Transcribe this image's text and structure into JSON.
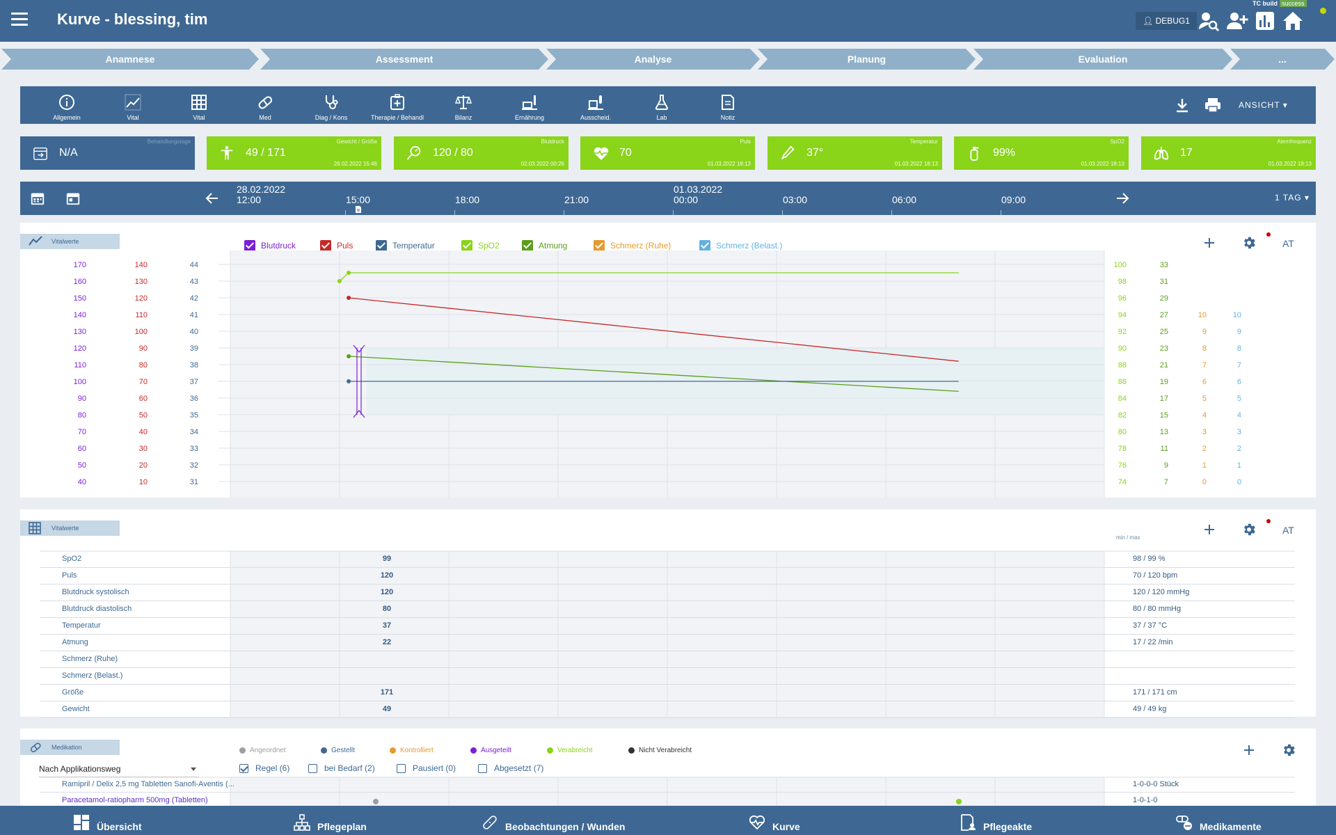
{
  "header": {
    "title": "Kurve - blessing, tim",
    "user": "DEBUG1",
    "tc_build": "TC build",
    "tc_status": "success"
  },
  "steps": [
    "Anamnese",
    "Assessment",
    "Analyse",
    "Planung",
    "Evaluation",
    "..."
  ],
  "toolbar": {
    "tools": [
      "Allgemein",
      "Vital",
      "Vital",
      "Med",
      "Diag / Kons",
      "Therapie / Behandl",
      "Bilanz",
      "Ernährung",
      "Ausscheid.",
      "Lab",
      "Notiz"
    ],
    "view_label": "ANSICHT"
  },
  "tiles": [
    {
      "caption": "Behandlungstage",
      "value": "N/A",
      "timestamp": ""
    },
    {
      "caption": "Gewicht / Größe",
      "value": "49 / 171",
      "timestamp": "28.02.2022 15:46"
    },
    {
      "caption": "Blutdruck",
      "value": "120 / 80",
      "timestamp": "02.03.2022 00:26"
    },
    {
      "caption": "Puls",
      "value": "70",
      "timestamp": "01.03.2022 18:13"
    },
    {
      "caption": "Temperatur",
      "value": "37°",
      "timestamp": "01.03.2022 18:13"
    },
    {
      "caption": "SpO2",
      "value": "99%",
      "timestamp": "01.03.2022 18:13"
    },
    {
      "caption": "Atemfrequenz",
      "value": "17",
      "timestamp": "01.03.2022 18:13"
    }
  ],
  "timebar": {
    "date1": "28.02.2022",
    "date2": "01.03.2022",
    "ticks": [
      "12:00",
      "15:00",
      "18:00",
      "21:00",
      "00:00",
      "03:00",
      "06:00",
      "09:00"
    ],
    "range": "1 TAG"
  },
  "chart_panel": {
    "tag": "Vitalwerte",
    "at": "AT",
    "legend": [
      {
        "name": "Blutdruck",
        "color": "#7b1fd6"
      },
      {
        "name": "Puls",
        "color": "#c62828"
      },
      {
        "name": "Temperatur",
        "color": "#3e6893"
      },
      {
        "name": "SpO2",
        "color": "#8ad41a"
      },
      {
        "name": "Atmung",
        "color": "#5a9e1b"
      },
      {
        "name": "Schmerz (Ruhe)",
        "color": "#e69a2e"
      },
      {
        "name": "Schmerz (Belast.)",
        "color": "#64b0e0"
      }
    ]
  },
  "chart_data": {
    "type": "line",
    "x_hours_labels": [
      "12:00",
      "15:00",
      "18:00",
      "21:00",
      "00:00",
      "03:00",
      "06:00",
      "09:00"
    ],
    "axes": {
      "blutdruck": {
        "ticks": [
          170,
          160,
          150,
          140,
          130,
          120,
          110,
          100,
          90,
          80,
          70,
          60,
          50,
          40
        ],
        "color": "#7b1fd6"
      },
      "puls": {
        "ticks": [
          140,
          130,
          120,
          110,
          100,
          90,
          80,
          70,
          60,
          50,
          40,
          30,
          20,
          10
        ],
        "color": "#c62828"
      },
      "temperatur": {
        "ticks": [
          44,
          43,
          42,
          41,
          40,
          39,
          38,
          37,
          36,
          35,
          34,
          33,
          32,
          31
        ],
        "color": "#3e6893"
      },
      "spo2": {
        "ticks": [
          100,
          98,
          96,
          94,
          92,
          90,
          88,
          86,
          84,
          82,
          80,
          78,
          76,
          74
        ],
        "color": "#8ad41a"
      },
      "atmung": {
        "ticks": [
          33,
          31,
          29,
          27,
          25,
          23,
          21,
          19,
          17,
          15,
          13,
          11,
          9,
          7
        ],
        "color": "#5a9e1b"
      },
      "schmerz_ruhe": {
        "ticks": [
          10,
          9,
          8,
          7,
          6,
          5,
          4,
          3,
          2,
          1,
          0
        ],
        "color": "#e69a2e"
      },
      "schmerz_belast": {
        "ticks": [
          10,
          9,
          8,
          7,
          6,
          5,
          4,
          3,
          2,
          1,
          0
        ],
        "color": "#64b0e0"
      }
    },
    "series": [
      {
        "name": "SpO2",
        "axis": "spo2",
        "color": "#8ad41a",
        "points": [
          [
            15.0,
            98
          ],
          [
            15.25,
            99
          ],
          [
            32.0,
            99
          ]
        ]
      },
      {
        "name": "Puls",
        "axis": "puls",
        "color": "#c62828",
        "points": [
          [
            15.25,
            120
          ],
          [
            32.0,
            82
          ]
        ]
      },
      {
        "name": "Atmung",
        "axis": "atmung",
        "color": "#5a9e1b",
        "points": [
          [
            15.25,
            22
          ],
          [
            32.0,
            17.8
          ]
        ]
      },
      {
        "name": "Temperatur",
        "axis": "temperatur",
        "color": "#3e6893",
        "points": [
          [
            15.25,
            37
          ],
          [
            32.0,
            37
          ]
        ]
      }
    ],
    "blutdruck_marker": {
      "time": 15.0,
      "systolic": 120,
      "diastolic": 80,
      "color": "#7b1fd6"
    }
  },
  "table_panel": {
    "tag": "Vitalwerte",
    "at": "AT",
    "minmax_header": "min / max",
    "rows": [
      {
        "name": "SpO2",
        "value": "99",
        "minmax": "98 / 99 %"
      },
      {
        "name": "Puls",
        "value": "120",
        "minmax": "70 / 120 bpm"
      },
      {
        "name": "Blutdruck systolisch",
        "value": "120",
        "minmax": "120 / 120 mmHg"
      },
      {
        "name": "Blutdruck diastolisch",
        "value": "80",
        "minmax": "80 / 80 mmHg"
      },
      {
        "name": "Temperatur",
        "value": "37",
        "minmax": "37 / 37 °C"
      },
      {
        "name": "Atmung",
        "value": "22",
        "minmax": "17 / 22 /min"
      },
      {
        "name": "Schmerz (Ruhe)",
        "value": "",
        "minmax": ""
      },
      {
        "name": "Schmerz (Belast.)",
        "value": "",
        "minmax": ""
      },
      {
        "name": "Größe",
        "value": "171",
        "minmax": "171 / 171 cm"
      },
      {
        "name": "Gewicht",
        "value": "49",
        "minmax": "49 / 49 kg"
      }
    ]
  },
  "med_panel": {
    "tag": "Medikation",
    "statuses": [
      {
        "name": "Angeordnet",
        "color": "#9e9e9e"
      },
      {
        "name": "Gestellt",
        "color": "#3e6893"
      },
      {
        "name": "Kontrolliert",
        "color": "#e69a2e"
      },
      {
        "name": "Ausgeteilt",
        "color": "#7b1fd6"
      },
      {
        "name": "Verabreicht",
        "color": "#8ad41a"
      },
      {
        "name": "Nicht Verabreicht",
        "color": "#333333"
      }
    ],
    "grouping": "Nach Applikationsweg",
    "filters": [
      {
        "label": "Regel (6)",
        "checked": true
      },
      {
        "label": "bei Bedarf (2)",
        "checked": false
      },
      {
        "label": "Pausiert (0)",
        "checked": false
      },
      {
        "label": "Abgesetzt (7)",
        "checked": false
      }
    ],
    "rows": [
      {
        "name": "Ramipril / Delix 2,5 mg Tabletten Sanofi-Aventis (...",
        "dose": "1-0-0-0 Stück"
      },
      {
        "name": "Paracetamol-ratiopharm 500mg (Tabletten)",
        "dose": "1-0-1-0"
      }
    ]
  },
  "bottomnav": [
    "Übersicht",
    "Pflegeplan",
    "Beobachtungen / Wunden",
    "Kurve",
    "Pflegeakte",
    "Medikamente"
  ]
}
